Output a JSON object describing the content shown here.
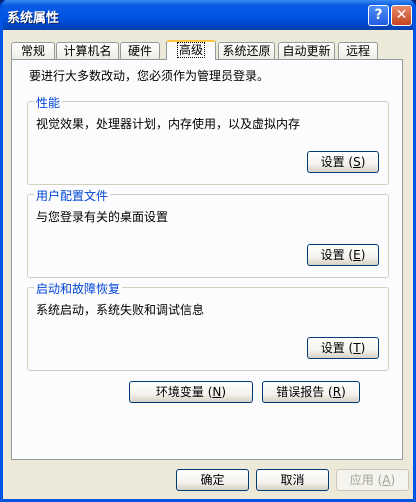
{
  "window": {
    "title": "系统属性"
  },
  "titlebar_buttons": {
    "help": "?",
    "close": "✕"
  },
  "tabs": [
    {
      "label": "常规"
    },
    {
      "label": "计算机名"
    },
    {
      "label": "硬件"
    },
    {
      "label": "高级"
    },
    {
      "label": "系统还原"
    },
    {
      "label": "自动更新"
    },
    {
      "label": "远程"
    }
  ],
  "advanced": {
    "intro": "要进行大多数改动，您必须作为管理员登录。",
    "groups": [
      {
        "title": "性能",
        "desc": "视觉效果，处理器计划，内存使用，以及虚拟内存",
        "button": "设置",
        "accel": "S"
      },
      {
        "title": "用户配置文件",
        "desc": "与您登录有关的桌面设置",
        "button": "设置",
        "accel": "E"
      },
      {
        "title": "启动和故障恢复",
        "desc": "系统启动，系统失败和调试信息",
        "button": "设置",
        "accel": "T"
      }
    ],
    "env_button": {
      "label": "环境变量",
      "accel": "N"
    },
    "error_button": {
      "label": "错误报告",
      "accel": "R"
    }
  },
  "footer": {
    "ok": "确定",
    "cancel": "取消",
    "apply": {
      "label": "应用",
      "accel": "A"
    }
  }
}
